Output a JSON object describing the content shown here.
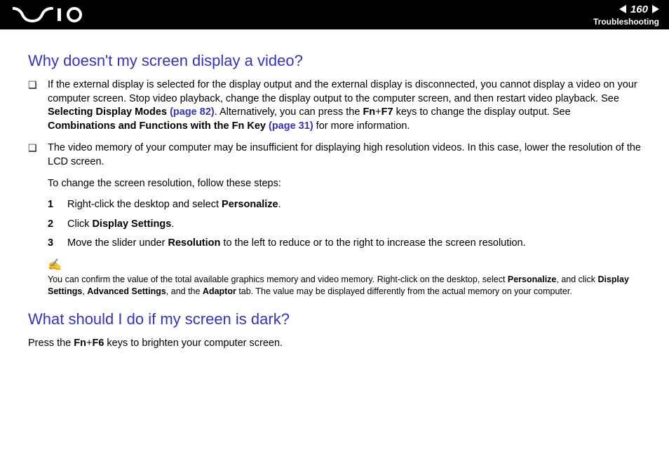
{
  "header": {
    "page_number": "160",
    "section": "Troubleshooting"
  },
  "heading1": "Why doesn't my screen display a video?",
  "bullet1": {
    "pre1": "If the external display is selected for the display output and the external display is disconnected, you cannot display a video on your computer screen. Stop video playback, change the display output to the computer screen, and then restart video playback. See ",
    "bold1": "Selecting Display Modes ",
    "link1": "(page 82)",
    "mid1": ". Alternatively, you can press the ",
    "bold2": "Fn",
    "plus1": "+",
    "bold3": "F7",
    "mid2": " keys to change the display output. See ",
    "bold4": "Combinations and Functions with the Fn Key ",
    "link2": "(page 31)",
    "post": " for more information."
  },
  "bullet2": "The video memory of your computer may be insufficient for displaying high resolution videos. In this case, lower the resolution of the LCD screen.",
  "subpara": "To change the screen resolution, follow these steps:",
  "steps": {
    "s1": {
      "n": "1",
      "pre": "Right-click the desktop and select ",
      "bold": "Personalize",
      "post": "."
    },
    "s2": {
      "n": "2",
      "pre": "Click ",
      "bold": "Display Settings",
      "post": "."
    },
    "s3": {
      "n": "3",
      "pre": "Move the slider under ",
      "bold": "Resolution",
      "post": " to the left to reduce or to the right to increase the screen resolution."
    }
  },
  "note": {
    "icon": "✍",
    "pre": "You can confirm the value of the total available graphics memory and video memory. Right-click on the desktop, select ",
    "b1": "Personalize",
    "m1": ", and click ",
    "b2": "Display Settings",
    "m2": ", ",
    "b3": "Advanced Settings",
    "m3": ", and the ",
    "b4": "Adaptor",
    "post": " tab. The value may be displayed differently from the actual memory on your computer."
  },
  "heading2": "What should I do if my screen is dark?",
  "para2": {
    "pre": "Press the ",
    "b1": "Fn",
    "plus": "+",
    "b2": "F6",
    "post": " keys to brighten your computer screen."
  }
}
